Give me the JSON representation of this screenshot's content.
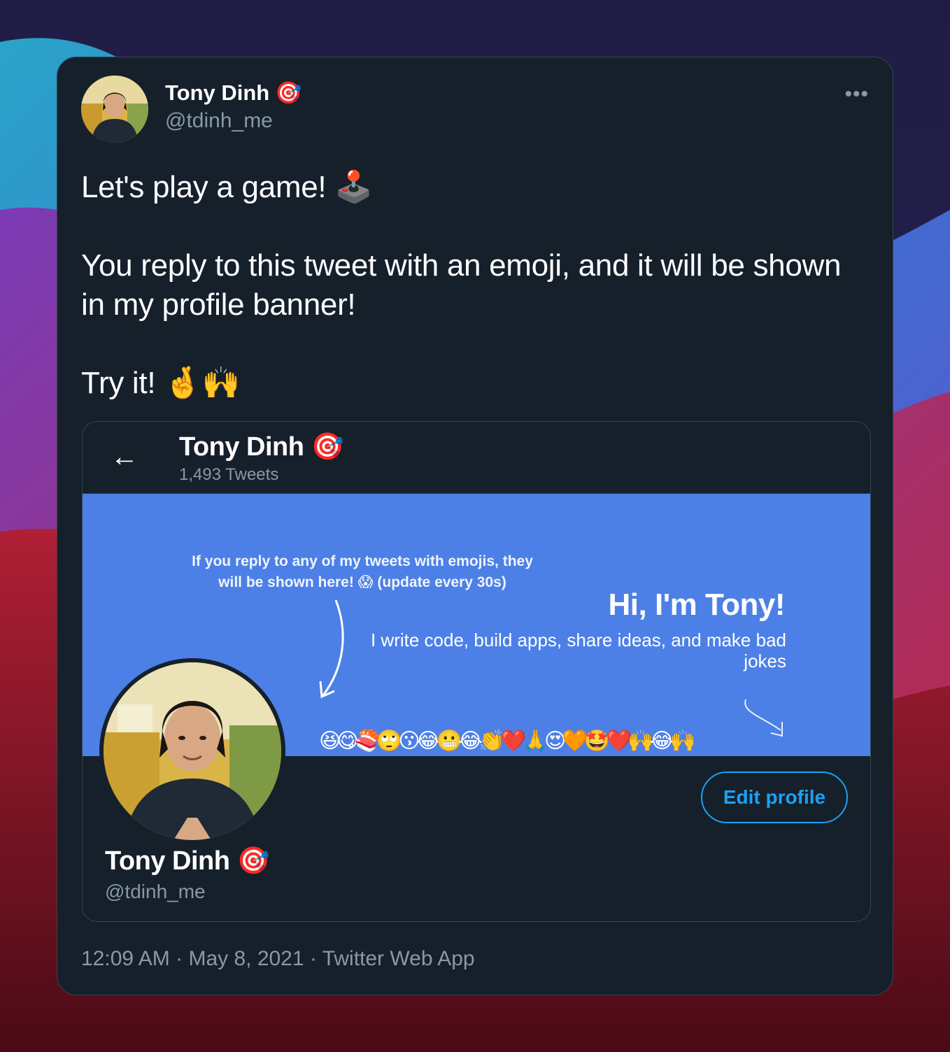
{
  "tweet": {
    "author_name": "Tony Dinh",
    "author_handle": "@tdinh_me",
    "verified_emoji": "🎯",
    "more_label": "•••",
    "text_line1": "Let's play a game! 🕹️",
    "text_line2": "You reply to this tweet with an emoji, and it will be shown in my profile banner!",
    "text_line3": "Try it! 🤞🙌",
    "time": "12:09 AM",
    "date": "May 8, 2021",
    "source": "Twitter Web App",
    "separator": "·"
  },
  "embed": {
    "back_icon": "←",
    "name": "Tony Dinh",
    "tweet_count": "1,493 Tweets",
    "banner": {
      "note": "If you reply to any of my tweets with emojis, they will be shown here! 😱 (update every 30s)",
      "title": "Hi, I'm Tony!",
      "subtitle": "I write code, build apps, share ideas, and make bad jokes",
      "emojis": "😆😋🍣🙄😗😂😬😂👏❤️🙏😍🧡🤩❤️🙌😂🙌",
      "color": "#4d80e6"
    },
    "edit_profile_label": "Edit profile",
    "profile_name": "Tony Dinh",
    "profile_handle": "@tdinh_me"
  },
  "colors": {
    "card_bg": "#15202b",
    "muted": "#8899a6",
    "accent": "#1da1f2"
  }
}
